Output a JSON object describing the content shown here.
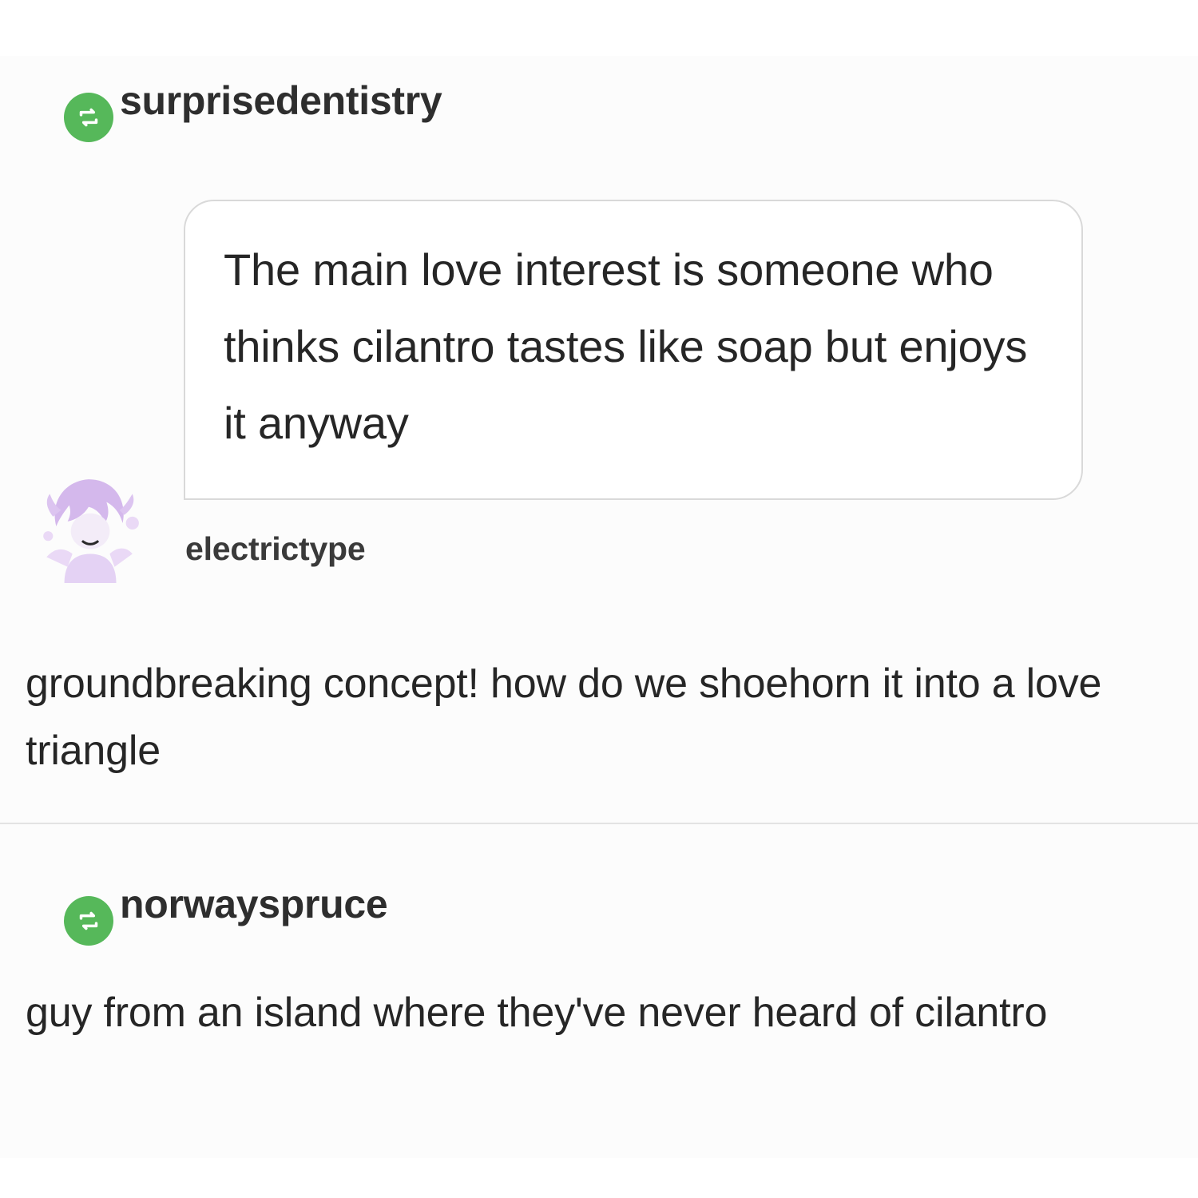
{
  "posts": [
    {
      "reblogger": "surprisedentistry",
      "ask": {
        "text": "The main love interest is someone who thinks cilantro tastes like soap but enjoys it anyway",
        "asker": "electrictype"
      },
      "reply": "groundbreaking concept! how do we shoehorn it into a love triangle"
    },
    {
      "reblogger": "norwayspruce",
      "reply": "guy from an island where they've never heard of cilantro"
    }
  ],
  "colors": {
    "reblog_badge": "#56b85a",
    "text": "#262626",
    "divider": "#e3e3e3",
    "avatar_tint": "#c9a6e6"
  },
  "icons": {
    "reblog": "reblog-arrows-icon",
    "avatar": "anime-avatar-icon"
  }
}
